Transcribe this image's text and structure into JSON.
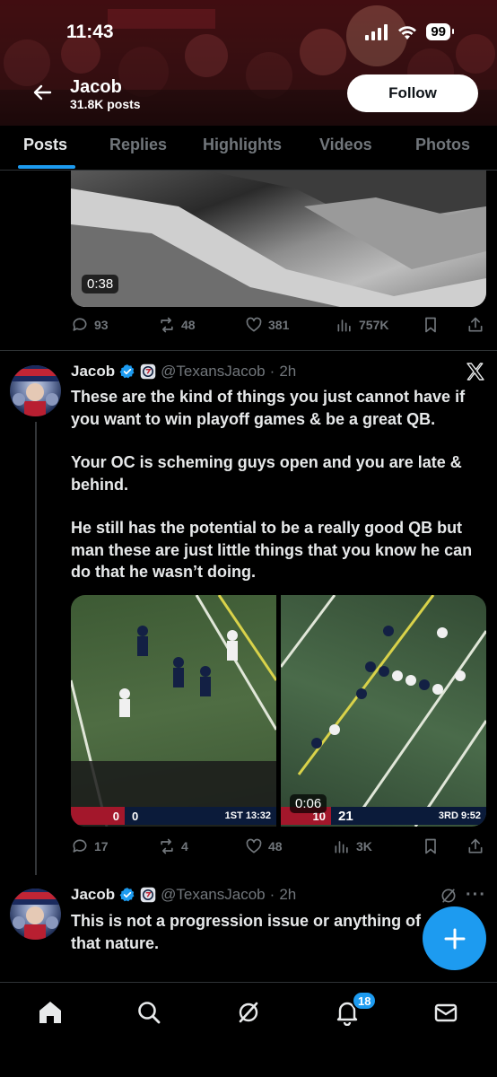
{
  "status_bar": {
    "time": "11:43",
    "battery": "99"
  },
  "header": {
    "name": "Jacob",
    "posts_count": "31.8K posts",
    "follow_label": "Follow"
  },
  "tabs": [
    {
      "label": "Posts",
      "active": true
    },
    {
      "label": "Replies"
    },
    {
      "label": "Highlights"
    },
    {
      "label": "Videos"
    },
    {
      "label": "Photos"
    }
  ],
  "prev_post": {
    "video_duration": "0:38",
    "replies": "93",
    "reposts": "48",
    "likes": "381",
    "views": "757K"
  },
  "post1": {
    "name": "Jacob",
    "handle": "@TexansJacob",
    "sep": "·",
    "time": "2h",
    "text_lines": [
      "These are the kind of things you just cannot have if you want to win playoff games & be a great QB.",
      "Your OC is scheming guys open and you are late & behind.",
      "He still has the potential to be a really good QB but man these are just little things that you know he can do that he wasn’t doing."
    ],
    "media": {
      "left_score_home": "0",
      "left_score_away": "0",
      "left_clock": "1ST 13:32",
      "right_score_home": "10",
      "right_score_away": "21",
      "right_clock": "3RD 9:52",
      "video_duration": "0:06"
    },
    "replies": "17",
    "reposts": "4",
    "likes": "48",
    "views": "3K"
  },
  "post2": {
    "name": "Jacob",
    "handle": "@TexansJacob",
    "sep": "·",
    "time": "2h",
    "more": "···",
    "text_lines": [
      "This is not a progression issue or anything of",
      "that nature."
    ]
  },
  "bottom_nav": {
    "notifications_count": "18"
  },
  "colors": {
    "accent": "#1d9bf0",
    "background": "#000000",
    "muted": "#71767b",
    "text": "#e7e9ea"
  },
  "icons": [
    "back-arrow-icon",
    "signal-icon",
    "wifi-icon",
    "battery-icon",
    "reply-icon",
    "repost-icon",
    "like-icon",
    "views-icon",
    "bookmark-icon",
    "share-icon",
    "verified-icon",
    "x-logo-icon",
    "grok-icon",
    "home-icon",
    "search-icon",
    "bell-icon",
    "mail-icon",
    "compose-plus-icon"
  ]
}
